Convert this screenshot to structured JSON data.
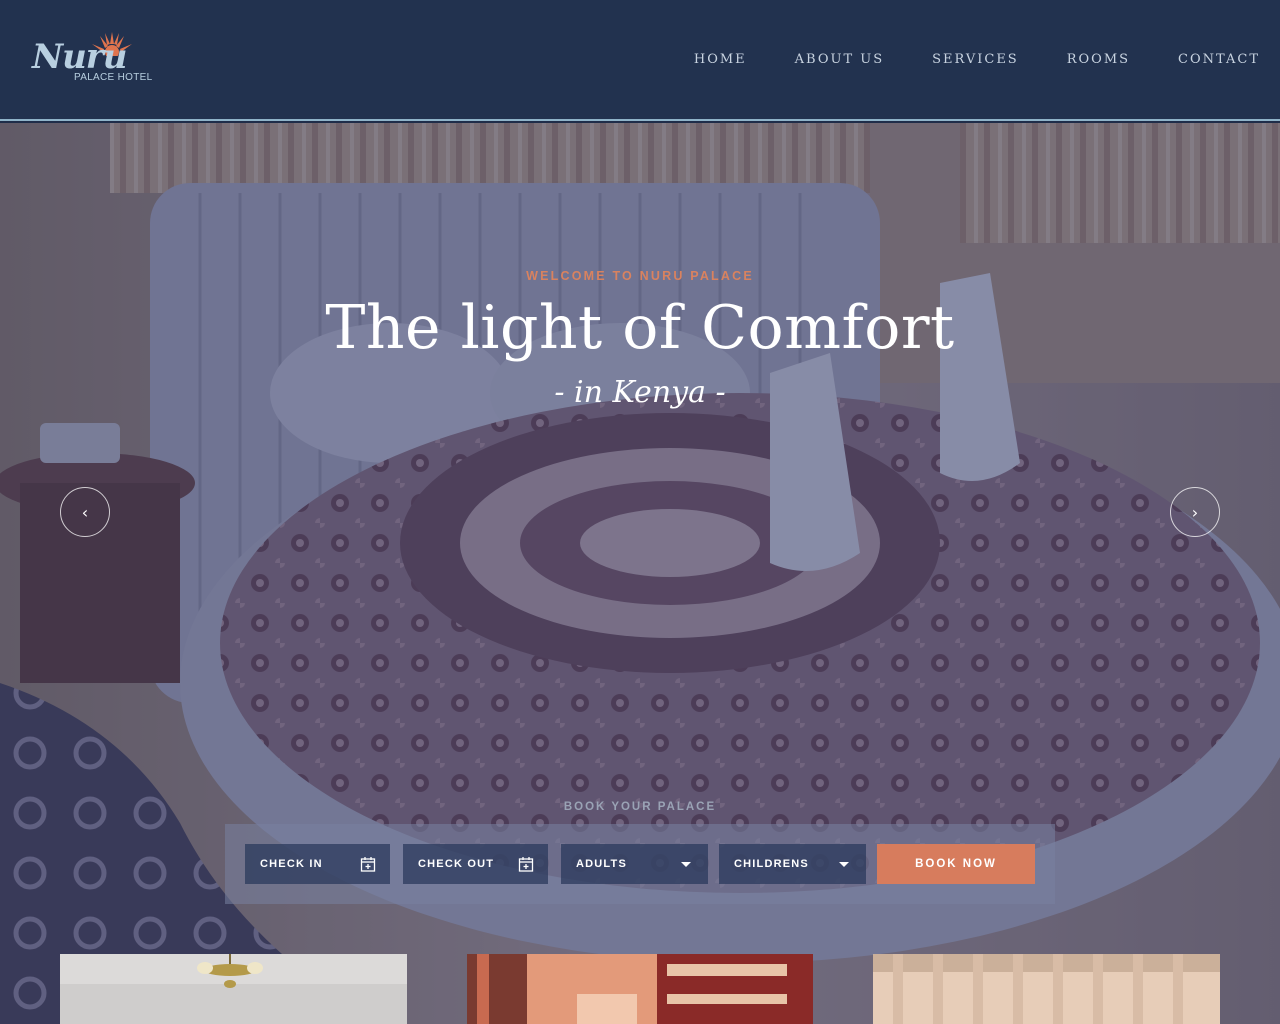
{
  "brand": {
    "logo_script": "Nuru",
    "logo_subtitle": "PALACE HOTEL"
  },
  "nav": {
    "items": [
      {
        "label": "HOME"
      },
      {
        "label": "ABOUT US"
      },
      {
        "label": "SERVICES"
      },
      {
        "label": "ROOMS"
      },
      {
        "label": "CONTACT"
      }
    ]
  },
  "hero": {
    "eyebrow": "WELCOME TO NURU PALACE",
    "title": "The light of Comfort",
    "subtitle": "- in Kenya -",
    "prev_icon": "chevron-left-icon",
    "next_icon": "chevron-right-icon"
  },
  "booking": {
    "label": "BOOK YOUR PALACE",
    "check_in": "CHECK IN",
    "check_out": "CHECK OUT",
    "adults": "ADULTS",
    "children": "CHILDRENS",
    "button": "BOOK NOW",
    "calendar_icon": "calendar-plus-icon",
    "dropdown_icon": "caret-down-icon"
  },
  "colors": {
    "header_bg": "#22324f",
    "accent": "#d77c5d",
    "header_border": "#8fb3c9",
    "nav_text": "#c8d3e0"
  }
}
